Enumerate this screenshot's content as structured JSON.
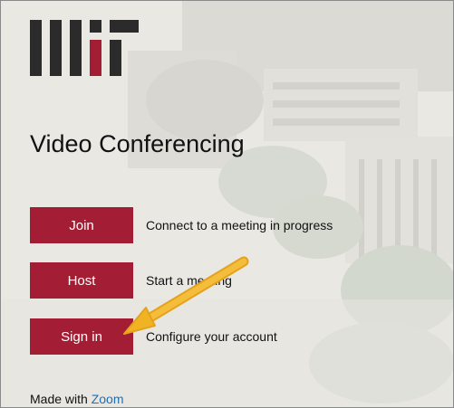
{
  "page": {
    "title": "Video Conferencing"
  },
  "logo": {
    "text": "MIT",
    "colors": {
      "dark": "#2b2b2b",
      "accent": "#a31e34"
    }
  },
  "actions": [
    {
      "label": "Join",
      "description": "Connect to a meeting in progress"
    },
    {
      "label": "Host",
      "description": "Start a meeting"
    },
    {
      "label": "Sign in",
      "description": "Configure your account"
    }
  ],
  "footer": {
    "prefix": "Made with",
    "link_label": "Zoom"
  },
  "annotation": {
    "icon": "arrow-icon",
    "color": "#f0b323"
  },
  "theme": {
    "button_color": "#a31e34",
    "link_color": "#1f6eb6",
    "text_color": "#111111"
  }
}
